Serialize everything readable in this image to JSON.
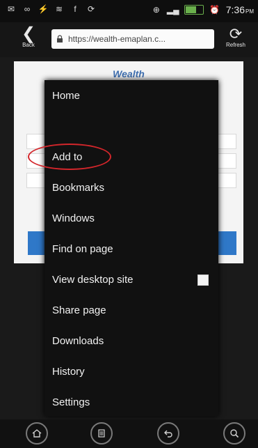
{
  "status_bar": {
    "time": "7:36",
    "ampm": "PM"
  },
  "toolbar": {
    "back_label": "Back",
    "url": "https://wealth-emaplan.c...",
    "refresh_label": "Refresh"
  },
  "page": {
    "title": "Wealth"
  },
  "menu": {
    "items": [
      {
        "label": "Home"
      },
      {
        "label": "Add to"
      },
      {
        "label": "Bookmarks"
      },
      {
        "label": "Windows"
      },
      {
        "label": "Find on page"
      },
      {
        "label": "View desktop site"
      },
      {
        "label": "Share page"
      },
      {
        "label": "Downloads"
      },
      {
        "label": "History"
      },
      {
        "label": "Settings"
      }
    ]
  },
  "colors": {
    "annotation": "#d3262b",
    "page_accent": "#2f78c8"
  },
  "icons": {
    "back": "back-arrow-icon",
    "refresh": "refresh-icon",
    "lock": "lock-icon",
    "home": "home-icon",
    "menu": "menu-icon",
    "back_nav": "back-icon",
    "search": "search-icon"
  }
}
